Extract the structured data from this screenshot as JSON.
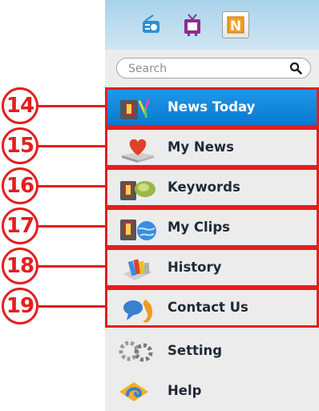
{
  "tabs": [
    {
      "name": "radio",
      "icon": "radio-icon"
    },
    {
      "name": "tv",
      "icon": "tv-icon"
    },
    {
      "name": "news",
      "icon": "news-n-icon",
      "selected": true
    }
  ],
  "search": {
    "placeholder": "Search",
    "value": ""
  },
  "menu": [
    {
      "label": "News Today",
      "icon": "news-today-icon",
      "active": true,
      "callout": "14"
    },
    {
      "label": "My News",
      "icon": "heart-inbox-icon",
      "callout": "15"
    },
    {
      "label": "Keywords",
      "icon": "keywords-icon",
      "callout": "16"
    },
    {
      "label": "My Clips",
      "icon": "clips-globe-icon",
      "callout": "17"
    },
    {
      "label": "History",
      "icon": "history-stack-icon",
      "callout": "18"
    },
    {
      "label": "Contact Us",
      "icon": "phone-bubble-icon",
      "callout": "19"
    },
    {
      "label": "Setting",
      "icon": "gear-icon"
    },
    {
      "label": "Help",
      "icon": "help-icon"
    }
  ],
  "colors": {
    "accent": "#1588df",
    "callout": "#e41e1e",
    "panel": "#ececec",
    "tabbar": "#bfe0f0"
  }
}
